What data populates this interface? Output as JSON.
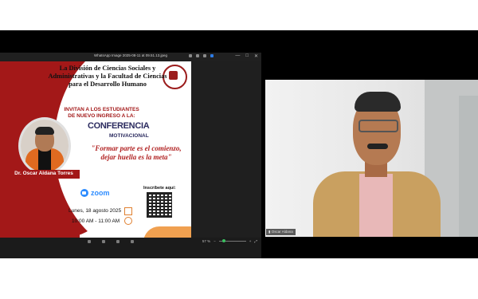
{
  "viewer": {
    "window_title": "WhatsApp Image 2025-08-11 at 09.51.13.jpeg",
    "controls": [
      "—",
      "□",
      "✕"
    ],
    "zoom_level": "57 %"
  },
  "flyer": {
    "heading_lines": [
      "La División de Ciencias Sociales y",
      "Administrativas  y la  Facultad de Ciencias",
      "para el Desarrollo Humano"
    ],
    "invite_lines": [
      "INVITAN A LOS ESTUDIANTES",
      "DE NUEVO INGRESO A LA:"
    ],
    "conferencia": "CONFERENCIA",
    "motivacional": "MOTIVACIONAL",
    "quote_lines": [
      "\"Formar parte es el comienzo,",
      "dejar huella es la meta\""
    ],
    "speaker": "Dr. Oscar Aldana Torres",
    "platform": "zoom",
    "register_label": "Inscríbete aquí:",
    "date": "Lunes, 18 agosto 2025",
    "time": "10:00 AM - 11:00 AM"
  },
  "participant": {
    "name": "Oscar Aldana"
  },
  "colors": {
    "flyer_red": "#a31818",
    "zoom_blue": "#2d8cff",
    "title_navy": "#2b2b5f",
    "accent_orange": "#f0a050"
  }
}
